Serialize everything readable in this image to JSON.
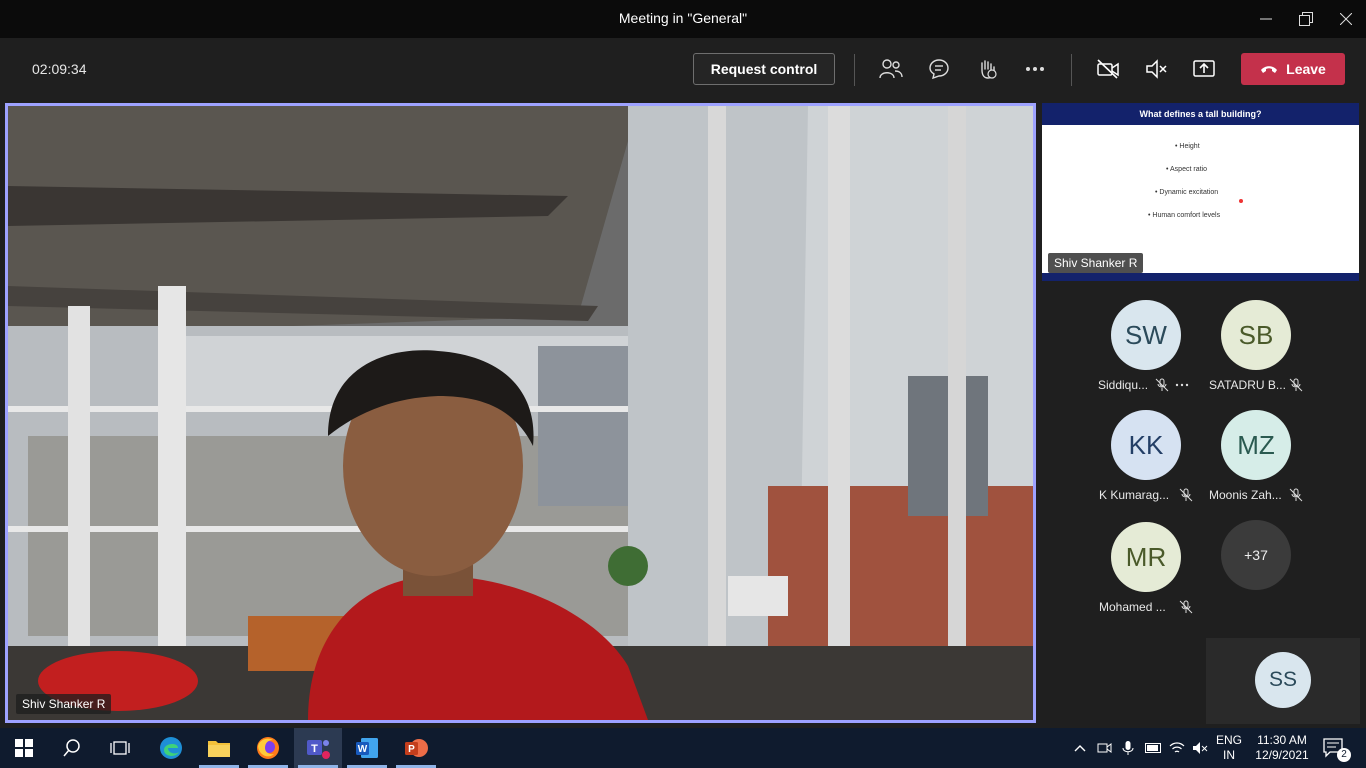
{
  "window": {
    "title": "Meeting in \"General\""
  },
  "toolbar": {
    "timer": "02:09:34",
    "request_control_label": "Request control",
    "leave_label": "Leave"
  },
  "main_video": {
    "speaker_name": "Shiv Shanker R"
  },
  "shared_content": {
    "presenter_name": "Shiv Shanker R",
    "slide_title": "What defines a tall building?",
    "bullets": [
      "Height",
      "Aspect ratio",
      "Dynamic excitation",
      "Human comfort levels"
    ]
  },
  "participants": [
    {
      "initials": "SW",
      "name": "Siddiqu...",
      "avatar_color": "#d9e6ee",
      "text_color": "#2b4a5a"
    },
    {
      "initials": "SB",
      "name": "SATADRU B...",
      "avatar_color": "#e5ebd6",
      "text_color": "#4a5a2a"
    },
    {
      "initials": "KK",
      "name": "K Kumarag...",
      "avatar_color": "#d6e2f2",
      "text_color": "#233e66"
    },
    {
      "initials": "MZ",
      "name": "Moonis Zah...",
      "avatar_color": "#d6ede8",
      "text_color": "#2a5a50"
    },
    {
      "initials": "MR",
      "name": "Mohamed ...",
      "avatar_color": "#e5ebd6",
      "text_color": "#4a5a2a"
    }
  ],
  "overflow_count": "+37",
  "self_view": {
    "initials": "SS"
  },
  "taskbar": {
    "language": "ENG",
    "region": "IN",
    "time": "11:30 AM",
    "date": "12/9/2021",
    "notification_count": "2"
  },
  "colors": {
    "leave_button": "#c4314b",
    "active_border": "#9ea2ff",
    "slide_header": "#13226b"
  }
}
